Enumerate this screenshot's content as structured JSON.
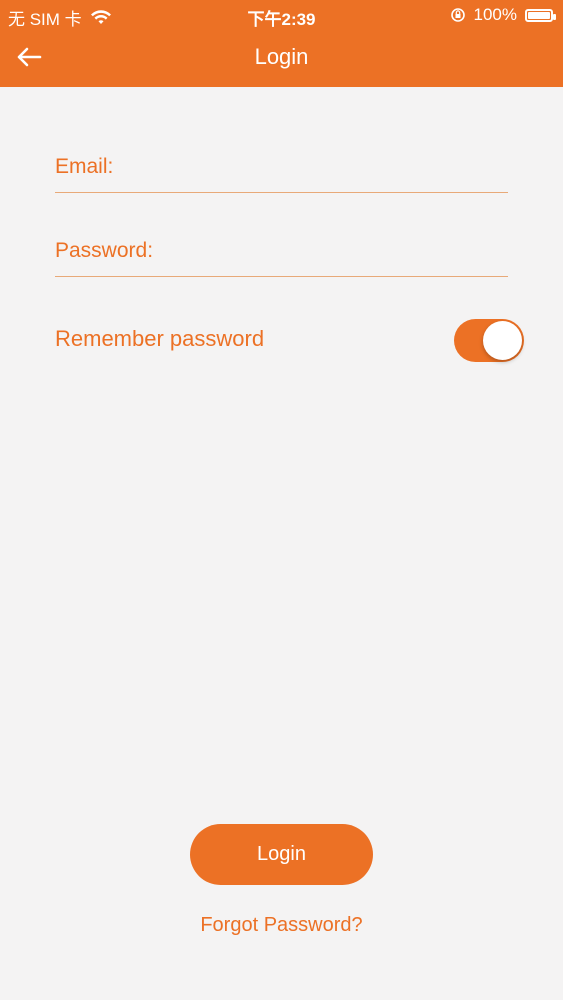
{
  "status_bar": {
    "carrier": "无 SIM 卡",
    "time": "下午2:39",
    "battery": "100%",
    "icons": [
      "wifi-icon",
      "orientation-lock-icon",
      "battery-icon"
    ]
  },
  "navbar": {
    "title": "Login",
    "back_icon": "arrow-left-icon"
  },
  "form": {
    "email_label": "Email:",
    "password_label": "Password:",
    "remember_label": "Remember password",
    "remember_enabled": true
  },
  "actions": {
    "login_label": "Login",
    "forgot_label": "Forgot Password?"
  },
  "colors": {
    "accent": "#ec7125",
    "background": "#f4f3f3",
    "divider": "#e8a978"
  }
}
